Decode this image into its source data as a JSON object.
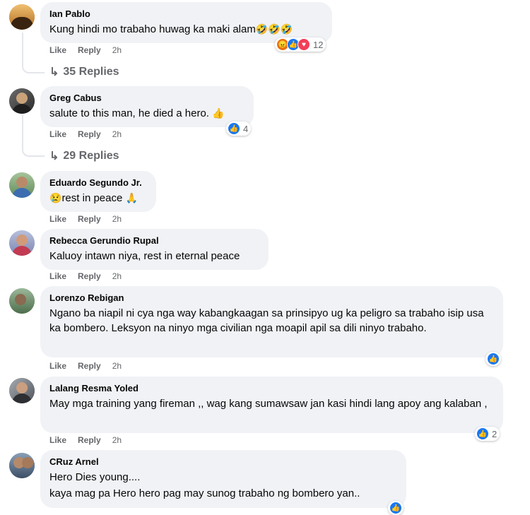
{
  "labels": {
    "like": "Like",
    "reply": "Reply"
  },
  "colors": {
    "bubble": "#f0f2f5",
    "meta": "#65676b",
    "like": "#1877f2"
  },
  "comments": [
    {
      "name": "Ian Pablo",
      "text": "Kung hindi mo trabaho huwag ka maki alam",
      "emoji": "🤣🤣🤣",
      "time": "2h",
      "reactions": [
        "angry-icon",
        "like-icon",
        "love-icon"
      ],
      "reaction_count": "12",
      "replies": "35 Replies"
    },
    {
      "name": "Greg Cabus",
      "text": "salute to this man, he died a hero.",
      "emoji": "👍",
      "time": "2h",
      "reactions": [
        "like-icon"
      ],
      "reaction_count": "4",
      "replies": "29 Replies"
    },
    {
      "name": "Eduardo Segundo Jr.",
      "pre_emoji": "😢",
      "text": "rest in peace",
      "emoji": "🙏",
      "time": "2h"
    },
    {
      "name": "Rebecca Gerundio Rupal",
      "text": "Kaluoy intawn niya, rest in eternal peace",
      "time": "2h"
    },
    {
      "name": "Lorenzo Rebigan",
      "text": "Ngano ba niapil ni cya nga way kabangkaagan sa prinsipyo ug ka peligro sa trabaho isip usa ka bombero. Leksyon na ninyo mga civilian nga moapil apil sa dili ninyo trabaho.",
      "time": "2h",
      "reactions": [
        "like-icon"
      ]
    },
    {
      "name": "Lalang Resma Yoled",
      "text": "May mga training yang fireman ,, wag kang sumawsaw jan kasi hindi lang apoy ang kalaban ,",
      "time": "2h",
      "reactions": [
        "like-icon"
      ],
      "reaction_count": "2"
    },
    {
      "name": "CRuz Arnel",
      "text": "Hero Dies young....",
      "text2": "kaya mag pa Hero hero pag may sunog trabaho ng bombero yan..",
      "reactions": [
        "like-icon"
      ]
    }
  ]
}
